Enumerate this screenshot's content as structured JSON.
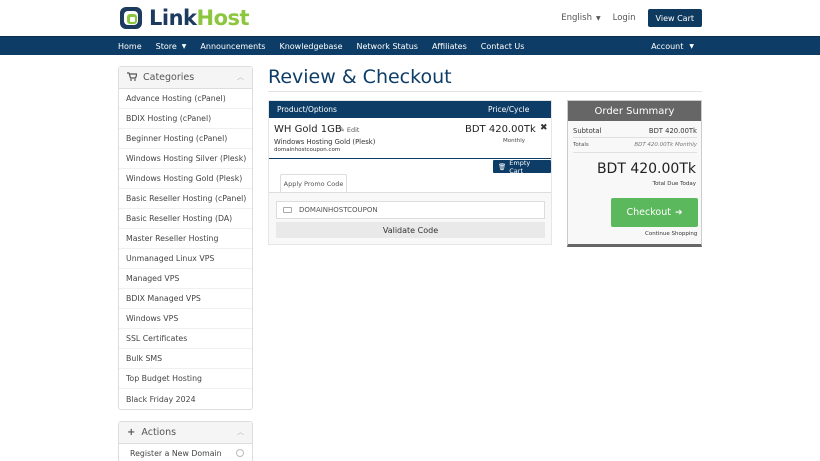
{
  "header": {
    "brand_link": "Link",
    "brand_host": "Host",
    "language": "English",
    "login": "Login",
    "view_cart": "View Cart"
  },
  "nav": {
    "items": [
      {
        "label": "Home",
        "dropdown": false
      },
      {
        "label": "Store",
        "dropdown": true
      },
      {
        "label": "Announcements",
        "dropdown": false
      },
      {
        "label": "Knowledgebase",
        "dropdown": false
      },
      {
        "label": "Network Status",
        "dropdown": false
      },
      {
        "label": "Affiliates",
        "dropdown": false
      },
      {
        "label": "Contact Us",
        "dropdown": false
      }
    ],
    "account": "Account"
  },
  "sidebar": {
    "categories_title": "Categories",
    "categories": [
      "Advance Hosting (cPanel)",
      "BDIX Hosting (cPanel)",
      "Beginner Hosting (cPanel)",
      "Windows Hosting Silver (Plesk)",
      "Windows Hosting Gold (Plesk)",
      "Basic Reseller Hosting (cPanel)",
      "Basic Reseller Hosting (DA)",
      "Master Reseller Hosting",
      "Unmanaged Linux VPS",
      "Managed VPS",
      "BDIX Managed VPS",
      "Windows VPS",
      "SSL Certificates",
      "Bulk SMS",
      "Top Budget Hosting",
      "Black Friday 2024"
    ],
    "actions_title": "Actions",
    "actions": [
      "Register a New Domain"
    ]
  },
  "main": {
    "title": "Review & Checkout",
    "cart": {
      "col_product": "Product/Options",
      "col_price": "Price/Cycle",
      "item": {
        "name": "WH Gold 1GB",
        "edit": "Edit",
        "group": "Windows Hosting Gold (Plesk)",
        "domain": "domainhostcoupon.com",
        "price": "BDT 420.00Tk",
        "cycle": "Monthly",
        "remove": "✖"
      },
      "empty_cart": "Empty Cart"
    },
    "promo": {
      "tab": "Apply Promo Code",
      "input_value": "DOMAINHOSTCOUPON",
      "validate": "Validate Code"
    }
  },
  "summary": {
    "title": "Order Summary",
    "subtotal_label": "Subtotal",
    "subtotal_value": "BDT 420.00Tk",
    "totals_label": "Totals",
    "totals_value": "BDT 420.00Tk Monthly",
    "total": "BDT 420.00Tk",
    "total_due": "Total Due Today",
    "checkout": "Checkout",
    "continue": "Continue Shopping"
  },
  "colors": {
    "primary": "#0d3d66",
    "brand_green": "#8cc63f",
    "checkout_green": "#5cb85c",
    "summary_grey": "#666666"
  }
}
